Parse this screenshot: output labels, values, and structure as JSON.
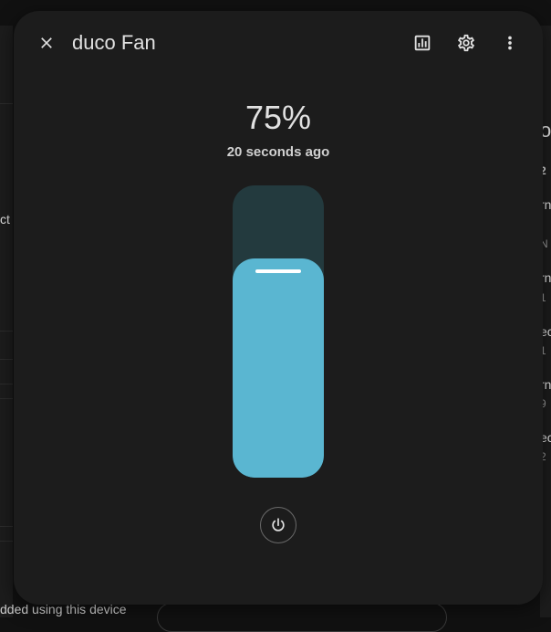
{
  "background": {
    "left_text": "ct",
    "bottom_text": "dded using this device",
    "right_fragments": [
      {
        "text": "ol",
        "kind": "big"
      },
      {
        "text": "2",
        "kind": "normal"
      },
      {
        "text": "rn",
        "kind": "normal"
      },
      {
        "text": "N",
        "kind": "small"
      },
      {
        "text": "rn",
        "kind": "normal"
      },
      {
        "text": "1",
        "kind": "small"
      },
      {
        "text": "ec",
        "kind": "normal"
      },
      {
        "text": "1",
        "kind": "small"
      },
      {
        "text": "rn",
        "kind": "normal"
      },
      {
        "text": "9",
        "kind": "small"
      },
      {
        "text": "ec",
        "kind": "normal"
      },
      {
        "text": "2",
        "kind": "small"
      }
    ]
  },
  "dialog": {
    "title": "duco Fan",
    "state": "75%",
    "last_changed": "20 seconds ago",
    "slider": {
      "percentage": 75,
      "color_fill": "#5ab6d1",
      "color_track": "#233a3e"
    },
    "icons": {
      "close": "close-icon",
      "history": "chart-box-icon",
      "settings": "gear-icon",
      "more": "dots-vertical-icon",
      "power": "power-icon"
    }
  }
}
